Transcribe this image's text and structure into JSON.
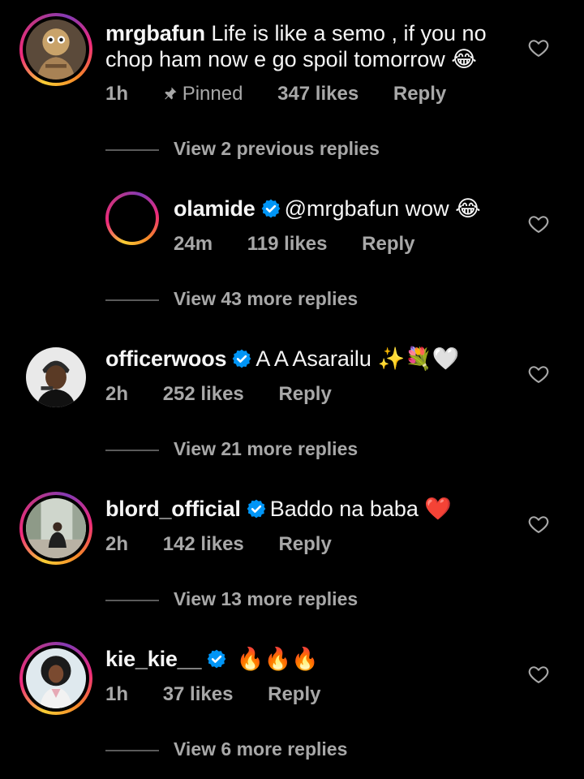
{
  "comments": [
    {
      "username": "mrgbafun",
      "verified": false,
      "text_line1": "Life is like a semo , if you no",
      "text_line2": "chop ham now e go spoil tomorrow",
      "emoji": "😂",
      "time": "1h",
      "pinned_label": "Pinned",
      "likes": "347 likes",
      "reply_label": "Reply"
    },
    {
      "username": "olamide",
      "verified": true,
      "text": "@mrgbafun wow",
      "emoji": "😂",
      "time": "24m",
      "likes": "119 likes",
      "reply_label": "Reply"
    },
    {
      "username": "officerwoos",
      "verified": true,
      "text": "A A Asarailu",
      "emoji": "✨💐🤍",
      "time": "2h",
      "likes": "252 likes",
      "reply_label": "Reply"
    },
    {
      "username": "blord_official",
      "verified": true,
      "text": "Baddo na baba",
      "emoji": "❤️",
      "time": "2h",
      "likes": "142 likes",
      "reply_label": "Reply"
    },
    {
      "username": "kie_kie__",
      "verified": true,
      "text": "",
      "emoji": "🔥🔥🔥",
      "time": "1h",
      "likes": "37 likes",
      "reply_label": "Reply"
    }
  ],
  "view_replies": [
    "View 2 previous replies",
    "View 43 more replies",
    "View 21 more replies",
    "View 13 more replies",
    "View 6 more replies"
  ],
  "colors": {
    "background": "#000000",
    "text": "#f5f5f5",
    "meta": "#a8a8a8",
    "verified": "#0095f6",
    "story_ring": "#ee2a7b"
  },
  "icons": {
    "heart": "heart-outline-icon",
    "pin": "pin-icon",
    "verified": "verified-badge-icon"
  }
}
